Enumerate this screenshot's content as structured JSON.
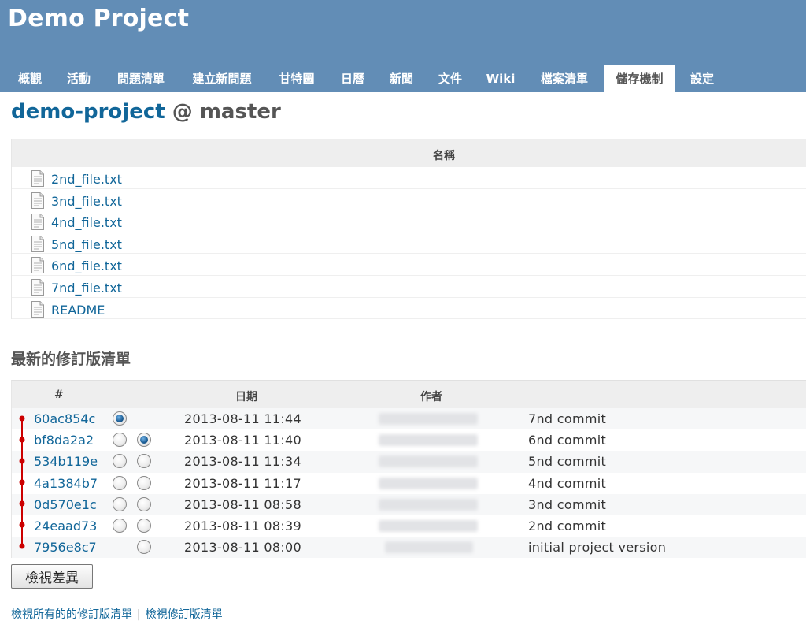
{
  "header": {
    "project_title": "Demo Project"
  },
  "menu": [
    {
      "label": "概觀"
    },
    {
      "label": "活動"
    },
    {
      "label": "問題清單"
    },
    {
      "label": "建立新問題"
    },
    {
      "label": "甘特圖"
    },
    {
      "label": "日曆"
    },
    {
      "label": "新聞"
    },
    {
      "label": "文件"
    },
    {
      "label": "Wiki"
    },
    {
      "label": "檔案清單"
    },
    {
      "label": "儲存機制",
      "selected": true
    },
    {
      "label": "設定"
    }
  ],
  "repo": {
    "name": "demo-project",
    "separator": "@",
    "branch": "master"
  },
  "files_table": {
    "column_header": "名稱",
    "files": [
      "2nd_file.txt",
      "3nd_file.txt",
      "4nd_file.txt",
      "5nd_file.txt",
      "6nd_file.txt",
      "7nd_file.txt",
      "README"
    ]
  },
  "revisions": {
    "heading": "最新的修訂版清單",
    "columns": {
      "number": "#",
      "date": "日期",
      "author": "作者"
    },
    "rows": [
      {
        "id": "60ac854c",
        "date": "2013-08-11 11:44",
        "comment": "7nd commit",
        "radio_from": "checked",
        "radio_to": "none"
      },
      {
        "id": "bf8da2a2",
        "date": "2013-08-11 11:40",
        "comment": "6nd commit",
        "radio_from": "unchecked",
        "radio_to": "checked"
      },
      {
        "id": "534b119e",
        "date": "2013-08-11 11:34",
        "comment": "5nd commit",
        "radio_from": "unchecked",
        "radio_to": "unchecked"
      },
      {
        "id": "4a1384b7",
        "date": "2013-08-11 11:17",
        "comment": "4nd commit",
        "radio_from": "unchecked",
        "radio_to": "unchecked"
      },
      {
        "id": "0d570e1c",
        "date": "2013-08-11 08:58",
        "comment": "3nd commit",
        "radio_from": "unchecked",
        "radio_to": "unchecked"
      },
      {
        "id": "24eaad73",
        "date": "2013-08-11 08:39",
        "comment": "2nd commit",
        "radio_from": "unchecked",
        "radio_to": "unchecked"
      },
      {
        "id": "7956e8c7",
        "date": "2013-08-11 08:00",
        "comment": "initial project version",
        "radio_from": "none",
        "radio_to": "unchecked"
      }
    ]
  },
  "buttons": {
    "view_diff": "檢視差異"
  },
  "footer": {
    "view_all_revisions": "檢視所有的的修訂版清單",
    "separator": "|",
    "view_revisions": "檢視修訂版清單"
  },
  "colors": {
    "header_bg": "#628db6",
    "link": "#116699",
    "graph": "#cc0000"
  }
}
